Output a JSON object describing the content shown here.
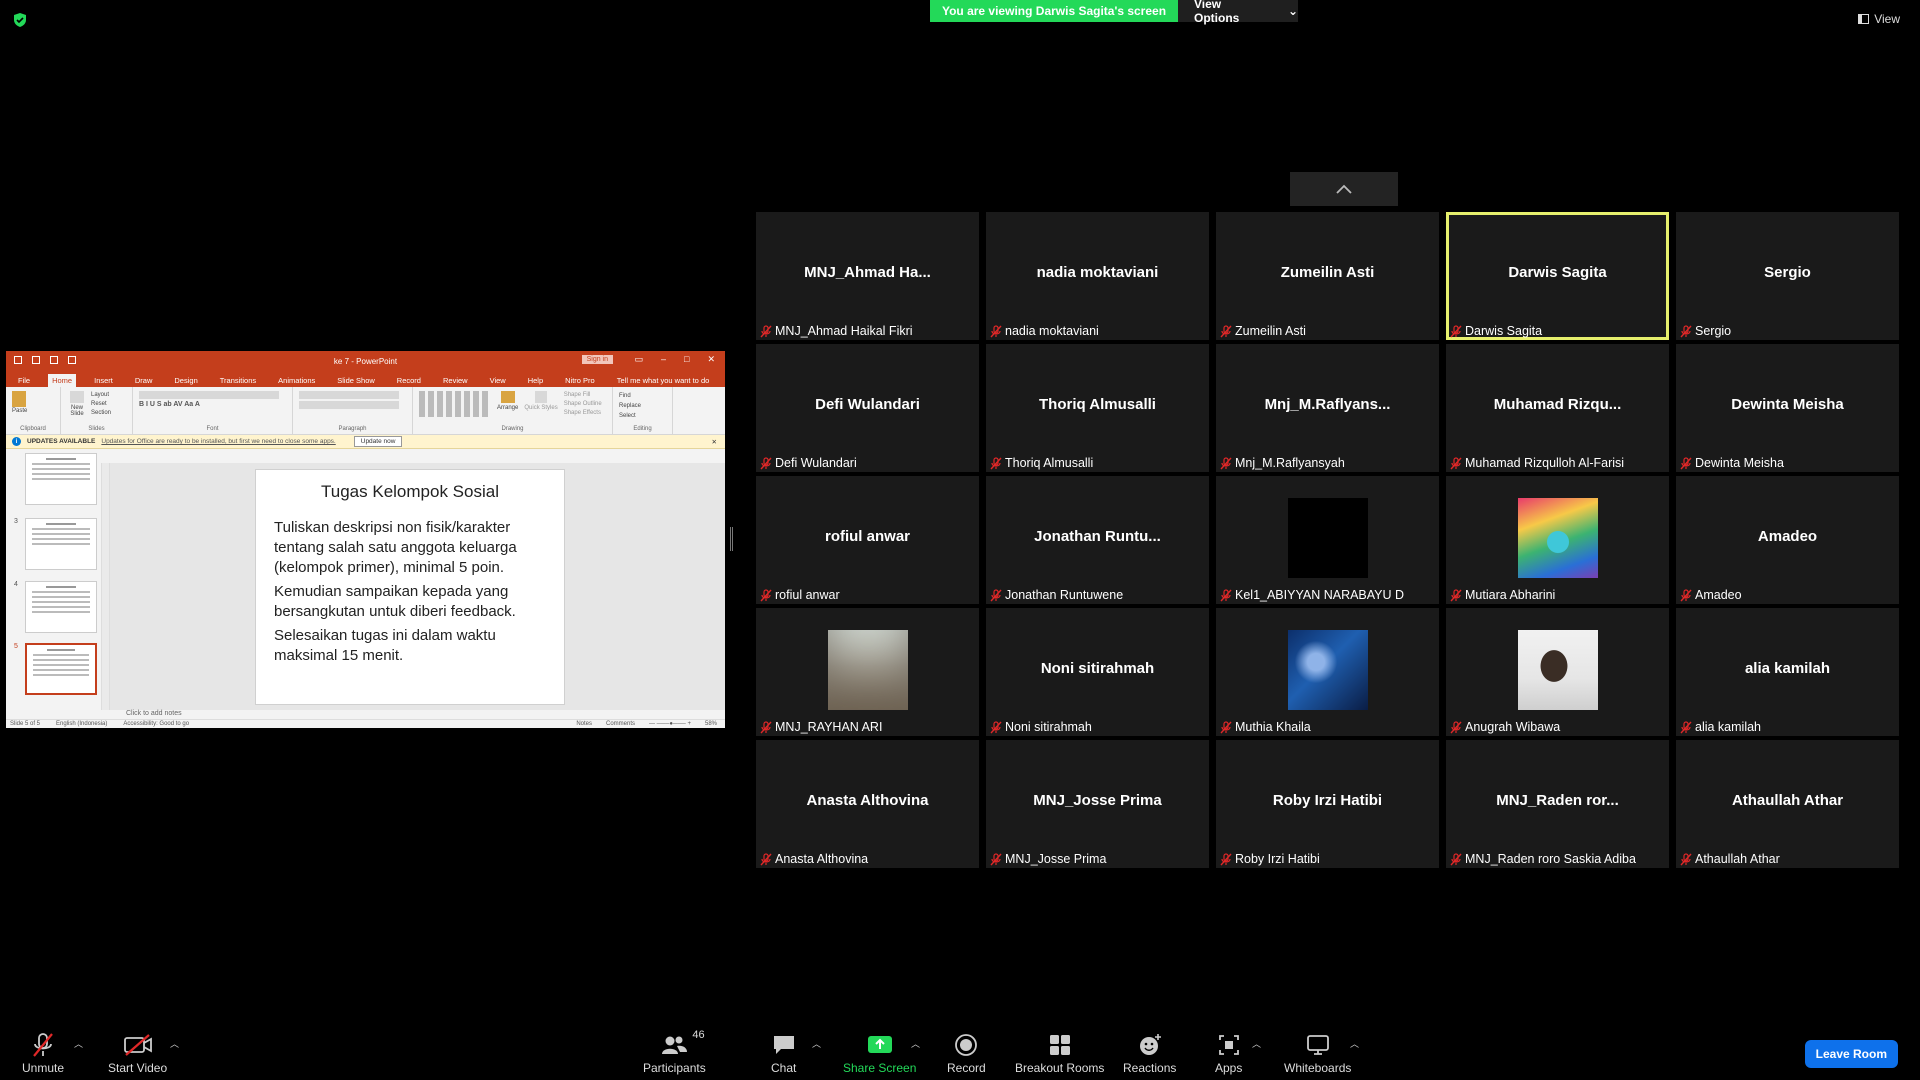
{
  "top": {
    "banner": "You are viewing Darwis Sagita's screen",
    "view_options": "View Options",
    "view": "View"
  },
  "shared": {
    "window_title": "ke 7  -  PowerPoint",
    "sign_in": "Sign in",
    "tabs": [
      "File",
      "Home",
      "Insert",
      "Draw",
      "Design",
      "Transitions",
      "Animations",
      "Slide Show",
      "Record",
      "Review",
      "View",
      "Help",
      "Nitro Pro",
      "Tell me what you want to do"
    ],
    "ribbon_groups": [
      "Clipboard",
      "Slides",
      "Font",
      "Paragraph",
      "Drawing",
      "Editing"
    ],
    "ribbon_buttons": {
      "paste": "Paste",
      "new_slide": "New Slide",
      "layout": "Layout",
      "reset": "Reset",
      "section": "Section",
      "arrange": "Arrange",
      "quick_styles": "Quick Styles",
      "shape_fill": "Shape Fill",
      "shape_outline": "Shape Outline",
      "shape_effects": "Shape Effects",
      "find": "Find",
      "replace": "Replace",
      "select": "Select"
    },
    "update": {
      "title": "UPDATES AVAILABLE",
      "message": "Updates for Office are ready to be installed, but first we need to close some apps.",
      "button": "Update now"
    },
    "thumb_numbers": [
      "3",
      "4",
      "5"
    ],
    "slide": {
      "title": "Tugas Kelompok Sosial",
      "paragraphs": [
        "Tuliskan deskripsi non fisik/karakter tentang salah satu anggota keluarga (kelompok primer), minimal 5 poin.",
        "Kemudian sampaikan kepada yang bersangkutan untuk diberi feedback.",
        "Selesaikan tugas ini dalam waktu maksimal 15 menit."
      ]
    },
    "notes_placeholder": "Click to add notes",
    "status": {
      "slide": "Slide 5 of 5",
      "language": "English (Indonesia)",
      "accessibility": "Accessibility: Good to go",
      "notes": "Notes",
      "comments": "Comments",
      "zoom": "58%"
    }
  },
  "participants": [
    {
      "display": "MNJ_Ahmad  Ha...",
      "label": "MNJ_Ahmad Haikal Fikri",
      "video": null,
      "active": false
    },
    {
      "display": "nadia moktaviani",
      "label": "nadia moktaviani",
      "video": null,
      "active": false
    },
    {
      "display": "Zumeilin Asti",
      "label": "Zumeilin Asti",
      "video": null,
      "active": false
    },
    {
      "display": "Darwis Sagita",
      "label": "Darwis Sagita",
      "video": null,
      "active": true
    },
    {
      "display": "Sergio",
      "label": "Sergio",
      "video": null,
      "active": false
    },
    {
      "display": "Defi Wulandari",
      "label": "Defi Wulandari",
      "video": null,
      "active": false
    },
    {
      "display": "Thoriq Almusalli",
      "label": "Thoriq Almusalli",
      "video": null,
      "active": false
    },
    {
      "display": "Mnj_M.Raflyans...",
      "label": "Mnj_M.Raflyansyah",
      "video": null,
      "active": false
    },
    {
      "display": "Muhamad  Rizqu...",
      "label": "Muhamad Rizqulloh Al-Farisi",
      "video": null,
      "active": false
    },
    {
      "display": "Dewinta Meisha",
      "label": "Dewinta Meisha",
      "video": null,
      "active": false
    },
    {
      "display": "rofiul anwar",
      "label": "rofiul anwar",
      "video": null,
      "active": false
    },
    {
      "display": "Jonathan  Runtu...",
      "label": "Jonathan Runtuwene",
      "video": null,
      "active": false
    },
    {
      "display": "",
      "label": "Kel1_ABIYYAN NARABAYU D",
      "video": "black",
      "active": false
    },
    {
      "display": "",
      "label": "Mutiara Abharini",
      "video": "colorful-art",
      "active": false
    },
    {
      "display": "Amadeo",
      "label": "Amadeo",
      "video": null,
      "active": false
    },
    {
      "display": "",
      "label": "MNJ_RAYHAN ARI",
      "video": "walkway-photo",
      "active": false
    },
    {
      "display": "Noni sitirahmah",
      "label": "Noni sitirahmah",
      "video": null,
      "active": false
    },
    {
      "display": "",
      "label": "Muthia Khaila",
      "video": "blue-abstract",
      "active": false
    },
    {
      "display": "",
      "label": "Anugrah Wibawa",
      "video": "selfie-photo",
      "active": false
    },
    {
      "display": "alia kamilah",
      "label": "alia kamilah",
      "video": null,
      "active": false
    },
    {
      "display": "Anasta Althovina",
      "label": "Anasta Althovina",
      "video": null,
      "active": false
    },
    {
      "display": "MNJ_Josse Prima",
      "label": "MNJ_Josse Prima",
      "video": null,
      "active": false
    },
    {
      "display": "Roby Irzi Hatibi",
      "label": "Roby Irzi Hatibi",
      "video": null,
      "active": false
    },
    {
      "display": "MNJ_Raden  ror...",
      "label": "MNJ_Raden roro Saskia Adiba",
      "video": null,
      "active": false
    },
    {
      "display": "Athaullah Athar",
      "label": "Athaullah Athar",
      "video": null,
      "active": false
    }
  ],
  "toolbar": {
    "unmute": "Unmute",
    "start_video": "Start Video",
    "participants": "Participants",
    "participants_count": "46",
    "chat": "Chat",
    "share_screen": "Share Screen",
    "record": "Record",
    "breakout_rooms": "Breakout Rooms",
    "reactions": "Reactions",
    "apps": "Apps",
    "whiteboards": "Whiteboards",
    "leave": "Leave Room"
  },
  "colors": {
    "banner_green": "#23d959",
    "active_speaker": "#e6ef6d",
    "leave_blue": "#0e71eb",
    "powerpoint_red": "#c43e1c",
    "mic_muted_red": "#e02828"
  },
  "icons": [
    "shield-icon",
    "view-grid-icon",
    "chevron-up-icon",
    "mic-muted-icon",
    "video-off-icon",
    "participants-icon",
    "chat-icon",
    "share-screen-icon",
    "record-icon",
    "breakout-rooms-icon",
    "reactions-icon",
    "apps-icon",
    "whiteboard-icon"
  ]
}
